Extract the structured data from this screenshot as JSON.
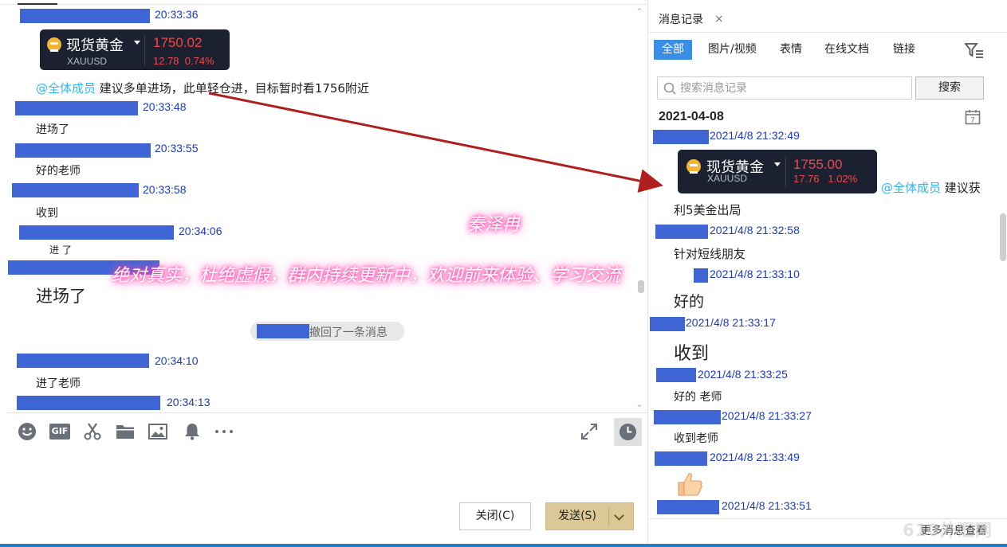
{
  "chat": {
    "messages": [
      {
        "time": "20:33:36"
      },
      {
        "time": "20:33:48",
        "text": "进场了"
      },
      {
        "time": "20:33:55",
        "text": "好的老师"
      },
      {
        "time": "20:33:58",
        "text": "收到"
      },
      {
        "time": "20:34:06",
        "text": "进了"
      },
      {
        "text": "进场了"
      },
      {
        "time": "20:34:10",
        "text": "进了老师"
      },
      {
        "time": "20:34:13"
      }
    ],
    "card": {
      "name": "现货黄金",
      "symbol": "XAUUSD",
      "price": "1750.02",
      "change": "12.78",
      "percent": "0.74%"
    },
    "mention": "@全体成员",
    "advice": "建议多单进场，此单轻仓进，目标暂时看1756附近",
    "recall_text": "撤回了一条消息"
  },
  "toolbar": {
    "gif": "GIF"
  },
  "buttons": {
    "close": "关闭(C)",
    "send": "发送(S)"
  },
  "record": {
    "title": "消息记录",
    "close": "×",
    "tabs": [
      "全部",
      "图片/视频",
      "表情",
      "在线文档",
      "链接"
    ],
    "search_placeholder": "搜索消息记录",
    "search_btn": "搜索",
    "date": "2021-04-08",
    "calendar_day": "7",
    "card": {
      "name": "现货黄金",
      "symbol": "XAUUSD",
      "price": "1755.00",
      "change": "17.76",
      "percent": "1.02%"
    },
    "mention": "@全体成员",
    "advice_start": "建议获",
    "advice_rest": "利5美金出局",
    "items": [
      {
        "time": "2021/4/8 21:32:49"
      },
      {
        "time": "2021/4/8 21:32:58",
        "text": "针对短线朋友"
      },
      {
        "time": "2021/4/8 21:33:10",
        "text": "好的"
      },
      {
        "time": "2021/4/8 21:33:17",
        "text": "收到"
      },
      {
        "time": "2021/4/8 21:33:25",
        "text": "好的  老师"
      },
      {
        "time": "2021/4/8 21:33:27",
        "text": "收到老师"
      },
      {
        "time": "2021/4/8 21:33:49"
      },
      {
        "time": "2021/4/8 21:33:51"
      }
    ],
    "more": "更多消息查看"
  },
  "overlay": {
    "name": "秦泽冉",
    "banner": "绝对真实，杜绝虚假，群内持续更新中，欢迎前来体验、学习交流"
  },
  "watermark": "610外汇网",
  "colors": {
    "redact": "#3f64d4",
    "timestamp": "#1d39c4",
    "accent": "#3a8ee6",
    "send": "#dcc896",
    "price": "#f04848",
    "arrow": "#b01e1e"
  }
}
